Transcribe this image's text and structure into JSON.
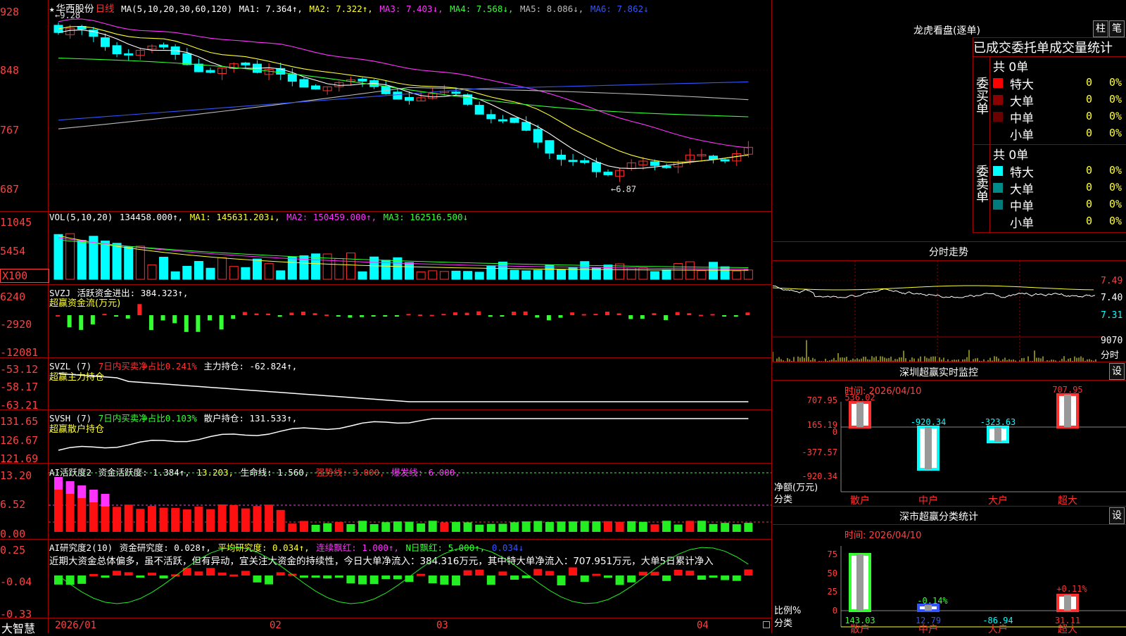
{
  "stock": {
    "star": "★",
    "name": "华西股份",
    "period": "日线",
    "high_mark": "9.28",
    "low_mark": "6.87"
  },
  "main_legend": {
    "ma_label": "MA(5,10,20,30,60,120)",
    "ma1": "MA1: 7.364↑,",
    "ma2": "MA2: 7.322↑,",
    "ma3": "MA3: 7.403↓,",
    "ma4": "MA4: 7.568↓,",
    "ma5": "MA5: 8.086↓,",
    "ma6": "MA6: 7.862↓"
  },
  "y_axes": {
    "price": [
      "928",
      "848",
      "767",
      "687"
    ],
    "vol": [
      "11045",
      "5454",
      "X100"
    ],
    "svzj": [
      "6240",
      "-2920",
      "-12081"
    ],
    "svzl": [
      "-53.12",
      "-58.17",
      "-63.21"
    ],
    "svsh": [
      "131.65",
      "126.67",
      "121.69"
    ],
    "active": [
      "13.20",
      "6.52",
      "0.00"
    ],
    "research": [
      "0.25",
      "-0.04",
      "-0.33"
    ]
  },
  "vol_legend": {
    "label": "VOL(5,10,20)",
    "v": "134458.000↑,",
    "ma1": "MA1: 145631.203↓,",
    "ma2": "MA2: 150459.000↑,",
    "ma3": "MA3: 162516.500↓"
  },
  "svzj_legend": {
    "label": "SVZJ",
    "text": "活跃资金进出: 384.323↑,",
    "sub": "超赢资金流(万元)"
  },
  "svzl_legend": {
    "label": "SVZL (7)",
    "ratio": "7日内买卖净占比0.241%",
    "text": "主力持仓: -62.824↑,",
    "sub": "超赢主力持仓"
  },
  "svsh_legend": {
    "label": "SVSH (7)",
    "ratio": "7日内买卖净占比0.103%",
    "text": "散户持仓: 131.533↑,",
    "sub": "超赢散户持仓"
  },
  "active_legend": {
    "label": "AI活跃度2",
    "a": "资金活跃度: 1.384↑,",
    "b": "13.203,",
    "c": "生命线: 1.560,",
    "d": "强势线: 3.000,",
    "e": "爆发线: 6.000,"
  },
  "research_legend": {
    "label": "AI研究度2(10)",
    "a": "资金研究度: 0.028↑,",
    "b": "平均研究度: 0.034↑,",
    "c": "连续飘红: 1.000↑,",
    "d": "N日飘红: 5.000↑,",
    "e": "0.034↓"
  },
  "research_note": "近期大资金总体偏多，虽不活跃，但有异动，宜关注大资金的持续性，今日大单净流入：384.316万元，其中特大单净流入：707.951万元，大单5日累计净入",
  "x_axis": {
    "brand": "大智慧",
    "labels": [
      "2026/01",
      "02",
      "03",
      "04"
    ]
  },
  "lhb": {
    "title": "龙虎看盘(逐单)",
    "btn1": "柱",
    "btn2": "笔",
    "header": "已成交委托单成交量统计",
    "buy_label": "委买单",
    "sell_label": "委卖单",
    "buy_total": "共 0单",
    "sell_total": "共 0单",
    "buy_rows": [
      {
        "name": "特大",
        "count": "0",
        "pct": "0%",
        "color": "#ff0000"
      },
      {
        "name": "大单",
        "count": "0",
        "pct": "0%",
        "color": "#8b0000"
      },
      {
        "name": "中单",
        "count": "0",
        "pct": "0%",
        "color": "#6b0000"
      },
      {
        "name": "小单",
        "count": "0",
        "pct": "0%",
        "color": "#000000"
      }
    ],
    "sell_rows": [
      {
        "name": "特大",
        "count": "0",
        "pct": "0%",
        "color": "#00ffff"
      },
      {
        "name": "大单",
        "count": "0",
        "pct": "0%",
        "color": "#008b8b"
      },
      {
        "name": "中单",
        "count": "0",
        "pct": "0%",
        "color": "#007a7a"
      },
      {
        "name": "小单",
        "count": "0",
        "pct": "0%",
        "color": "#000000"
      }
    ]
  },
  "intraday": {
    "title": "分时走势",
    "y": [
      "7.49",
      "7.40",
      "7.31"
    ],
    "vol": "9070",
    "unit": "分时"
  },
  "monitor": {
    "title": "深圳超赢实时监控",
    "btn": "设",
    "time": "时间: 2026/04/10",
    "y": [
      "707.95",
      "165.19",
      "0",
      "-377.57",
      "-920.34"
    ],
    "ylabel": "净额(万元)",
    "xlabel": "分类",
    "categories": [
      "散户",
      "中户",
      "大户",
      "超大"
    ],
    "values": [
      "536.02",
      "-920.34",
      "-323.63",
      "707.95"
    ]
  },
  "classify": {
    "title": "深市超赢分类统计",
    "btn": "设",
    "time": "时间: 2026/04/10",
    "y": [
      "75",
      "50",
      "25",
      "0"
    ],
    "ylabel": "比例%",
    "xlabel": "分类",
    "categories": [
      "散户",
      "中户",
      "大户",
      "超大"
    ],
    "values": [
      "143.03",
      "12.79",
      "-86.94",
      "31.11"
    ],
    "labels": [
      "-0.14%",
      "+0.11%"
    ]
  },
  "chart_data": [
    {
      "type": "candlestick",
      "title": "华西股份 日线",
      "ylim": [
        6.87,
        9.28
      ],
      "x": [
        "2026/01",
        "02",
        "03",
        "04"
      ],
      "series": [
        {
          "name": "MA1",
          "last": 7.364
        },
        {
          "name": "MA2",
          "last": 7.322
        },
        {
          "name": "MA3",
          "last": 7.403
        },
        {
          "name": "MA4",
          "last": 7.568
        },
        {
          "name": "MA5",
          "last": 8.086
        },
        {
          "name": "MA6",
          "last": 7.862
        }
      ]
    },
    {
      "type": "bar",
      "title": "深圳超赢实时监控",
      "categories": [
        "散户",
        "中户",
        "大户",
        "超大"
      ],
      "values": [
        536.02,
        -920.34,
        -323.63,
        707.95
      ],
      "ylim": [
        -920.34,
        707.95
      ]
    },
    {
      "type": "bar",
      "title": "深市超赢分类统计",
      "categories": [
        "散户",
        "中户",
        "大户",
        "超大"
      ],
      "values": [
        143.03,
        12.79,
        -86.94,
        31.11
      ]
    }
  ]
}
